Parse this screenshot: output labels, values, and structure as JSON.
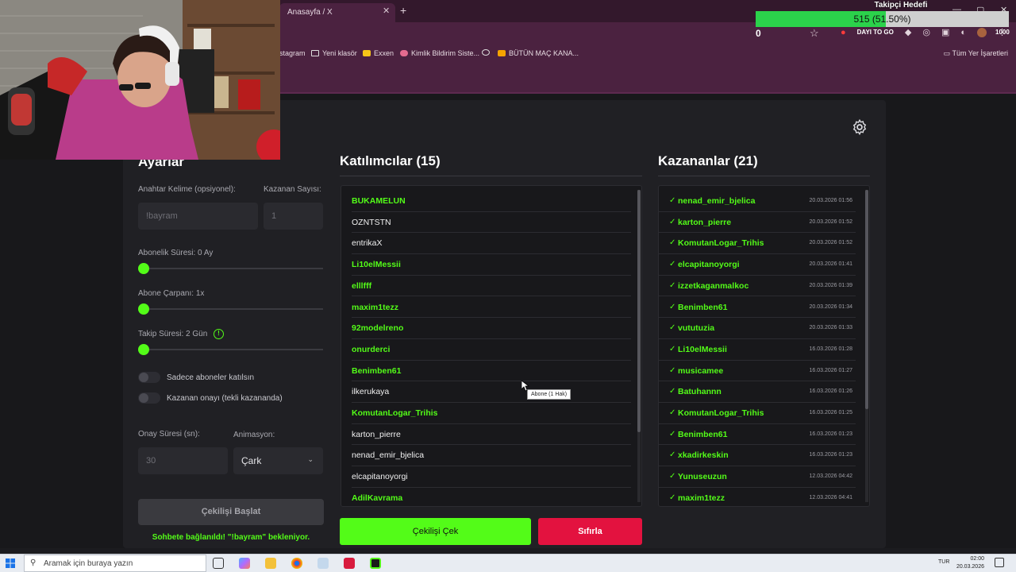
{
  "browser": {
    "tab_title": "Anasayfa / X",
    "bookmarks": [
      "stagram",
      "Yeni klasör",
      "Exxen",
      "Kimlik Bildirim Siste...",
      "BÜTÜN MAÇ KANA..."
    ],
    "bookmarks_all": "Tüm Yer İşaretleri",
    "addr_badge": "DAYI TO GO"
  },
  "goal": {
    "title": "Takipçi Hedefi",
    "progress_text": "515 (51.50%)",
    "progress": 0.515,
    "min": "0",
    "max": "1000"
  },
  "settings": {
    "title": "Ayarlar",
    "keyword_label": "Anahtar Kelime (opsiyonel):",
    "keyword_placeholder": "!bayram",
    "winners_count_label": "Kazanan Sayısı:",
    "winners_count_placeholder": "1",
    "subscription_label": "Abonelik Süresi: 0 Ay",
    "multiplier_label": "Abone Çarpanı: 1x",
    "follow_label": "Takip Süresi:",
    "follow_value": "2",
    "follow_unit": "Gün",
    "only_subs_label": "Sadece aboneler katılsın",
    "winner_confirm_label": "Kazanan onayı (tekli kazananda)",
    "confirm_time_label": "Onay Süresi (sn):",
    "confirm_time_placeholder": "30",
    "animation_label": "Animasyon:",
    "animation_value": "Çark",
    "start_button": "Çekilişi Başlat",
    "status": "Sohbete bağlanıldı! \"!bayram\" bekleniyor."
  },
  "participants": {
    "title": "Katılımcılar (15)",
    "items": [
      {
        "name": "BUKAMELUN",
        "sub": true
      },
      {
        "name": "OZNTSTN",
        "sub": false
      },
      {
        "name": "entrikaX",
        "sub": false
      },
      {
        "name": "Li10elMessii",
        "sub": true
      },
      {
        "name": "elllfff",
        "sub": true
      },
      {
        "name": "maxim1tezz",
        "sub": true
      },
      {
        "name": "92modelreno",
        "sub": true
      },
      {
        "name": "onurderci",
        "sub": true
      },
      {
        "name": "Benimben61",
        "sub": true
      },
      {
        "name": "ilkerukaya",
        "sub": false
      },
      {
        "name": "KomutanLogar_Trihis",
        "sub": true
      },
      {
        "name": "karton_pierre",
        "sub": false
      },
      {
        "name": "nenad_emir_bjelica",
        "sub": false
      },
      {
        "name": "elcapitanoyorgi",
        "sub": false
      },
      {
        "name": "AdilKavrama",
        "sub": true
      }
    ],
    "tooltip": "Abone (1 Hak)",
    "draw_button": "Çekilişi Çek",
    "reset_button": "Sıfırla"
  },
  "winners": {
    "title": "Kazananlar (21)",
    "check": "✓",
    "items": [
      {
        "name": "nenad_emir_bjelica",
        "date": "20.03.2026 01:56"
      },
      {
        "name": "karton_pierre",
        "date": "20.03.2026 01:52"
      },
      {
        "name": "KomutanLogar_Trihis",
        "date": "20.03.2026 01:52"
      },
      {
        "name": "elcapitanoyorgi",
        "date": "20.03.2026 01:41"
      },
      {
        "name": "izzetkaganmalkoc",
        "date": "20.03.2026 01:39"
      },
      {
        "name": "Benimben61",
        "date": "20.03.2026 01:34"
      },
      {
        "name": "vututuzia",
        "date": "20.03.2026 01:33"
      },
      {
        "name": "Li10elMessii",
        "date": "16.03.2026 01:28"
      },
      {
        "name": "musicamee",
        "date": "16.03.2026 01:27"
      },
      {
        "name": "Batuhannn",
        "date": "16.03.2026 01:26"
      },
      {
        "name": "KomutanLogar_Trihis",
        "date": "16.03.2026 01:25"
      },
      {
        "name": "Benimben61",
        "date": "16.03.2026 01:23"
      },
      {
        "name": "xkadirkeskin",
        "date": "16.03.2026 01:23"
      },
      {
        "name": "Yunuseuzun",
        "date": "12.03.2026 04:42"
      },
      {
        "name": "maxim1tezz",
        "date": "12.03.2026 04:41"
      }
    ]
  },
  "taskbar": {
    "search_placeholder": "Aramak için buraya yazın",
    "lang": "TUR",
    "time": "02:00",
    "date": "20.03.2026"
  },
  "colors": {
    "accent": "#53fc18",
    "danger": "#e3123f",
    "chrome": "#4b2240"
  }
}
